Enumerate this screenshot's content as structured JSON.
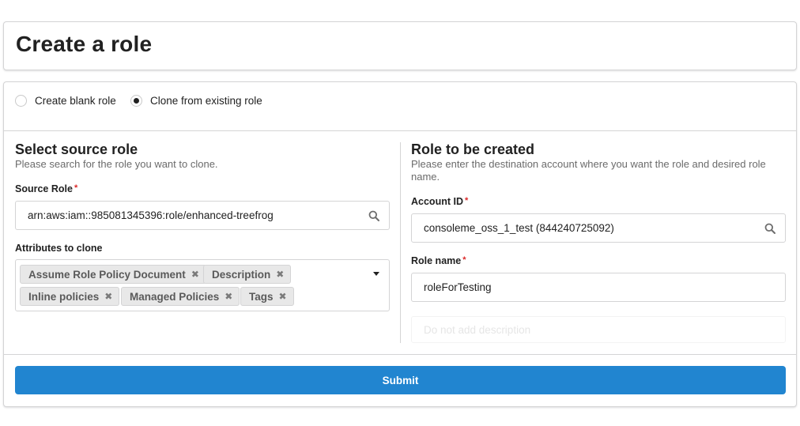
{
  "header": {
    "title": "Create a role"
  },
  "mode": {
    "options": [
      {
        "label": "Create blank role",
        "selected": false
      },
      {
        "label": "Clone from existing role",
        "selected": true
      }
    ]
  },
  "source": {
    "title": "Select source role",
    "description": "Please search for the role you want to clone.",
    "role_label": "Source Role",
    "role_value": "arn:aws:iam::985081345396:role/enhanced-treefrog",
    "attributes_label": "Attributes to clone",
    "attributes": [
      "Assume Role Policy Document",
      "Description",
      "Inline policies",
      "Managed Policies",
      "Tags"
    ]
  },
  "target": {
    "title": "Role to be created",
    "description": "Please enter the destination account where you want the role and desired role name.",
    "account_label": "Account ID",
    "account_value": "consoleme_oss_1_test (844240725092)",
    "name_label": "Role name",
    "name_value": "roleForTesting",
    "ghost_text": "Do not add description"
  },
  "required_mark": "*",
  "submit_label": "Submit",
  "colors": {
    "primary": "#2185d0",
    "required": "#db2828"
  }
}
